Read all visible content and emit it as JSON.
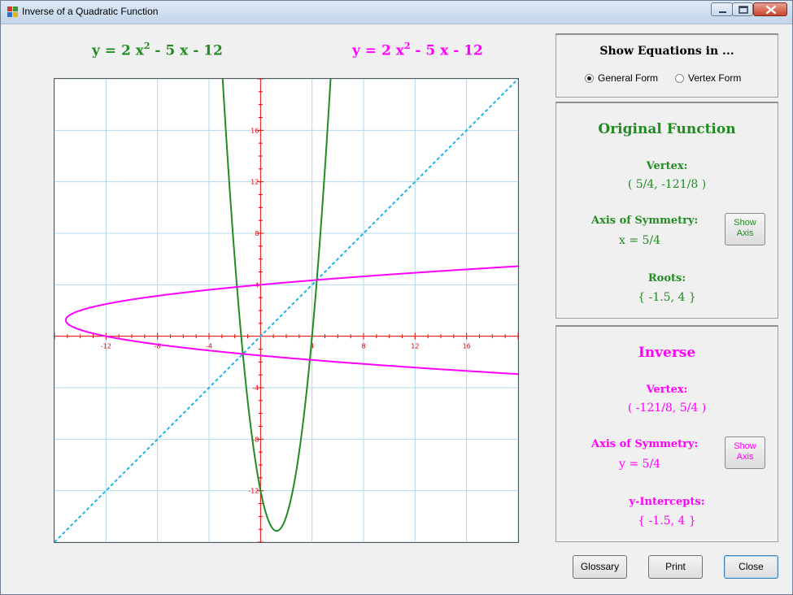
{
  "window": {
    "title": "Inverse of a Quadratic Function"
  },
  "equations": {
    "original": {
      "prefix": "y  =  2 x",
      "exp": "2",
      "suffix": "  -  5 x  -  12",
      "color": "#228b22"
    },
    "inverse": {
      "prefix": "y  =  2 x",
      "exp": "2",
      "suffix": "  -  5 x  -  12",
      "color": "#ff00ff"
    }
  },
  "graph": {
    "xlim": [
      -16,
      20
    ],
    "ylim": [
      -16,
      20
    ],
    "x_tick_labels": [
      "-12",
      "-8",
      "-4",
      "4",
      "8",
      "12",
      "16"
    ],
    "y_tick_labels": [
      "16",
      "12",
      "8",
      "4",
      "-4",
      "-8",
      "-12"
    ],
    "original_curve": {
      "a": 2,
      "b": -5,
      "c": -12,
      "color": "#228b22"
    },
    "inverse_curve": {
      "a": 2,
      "b": -5,
      "c": -12,
      "color": "#ff00ff"
    },
    "identity_line_color": "#1eb4e6",
    "grid_color": "#b0d8ee",
    "axis_color": "#e00000"
  },
  "display_panel": {
    "title": "Show Equations in ...",
    "options": [
      {
        "label": "General Form",
        "selected": true
      },
      {
        "label": "Vertex Form",
        "selected": false
      }
    ]
  },
  "original_panel": {
    "title": "Original Function",
    "vertex_label": "Vertex:",
    "vertex_value": "( 5/4, -121/8 )",
    "axis_label": "Axis of Symmetry:",
    "axis_value": "x  =  5/4",
    "axis_button": {
      "line1": "Show",
      "line2": "Axis"
    },
    "roots_label": "Roots:",
    "roots_value": "{ -1.5, 4 }"
  },
  "inverse_panel": {
    "title": "Inverse",
    "vertex_label": "Vertex:",
    "vertex_value": "( -121/8, 5/4 )",
    "axis_label": "Axis of Symmetry:",
    "axis_value": "y  =  5/4",
    "axis_button": {
      "line1": "Show",
      "line2": "Axis"
    },
    "intercepts_label": "y-Intercepts:",
    "intercepts_value": "{ -1.5, 4 }"
  },
  "buttons": {
    "glossary": "Glossary",
    "print": "Print",
    "close": "Close"
  }
}
